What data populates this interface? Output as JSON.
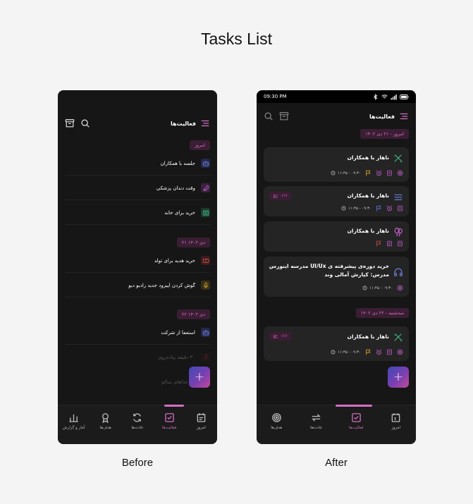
{
  "page_title": "Tasks List",
  "captions": {
    "before": "Before",
    "after": "After"
  },
  "colors": {
    "accent": "#d46fc3",
    "chip_bg": "#3a1e33",
    "card_bg": "#242424",
    "screen_bg": "#161616"
  },
  "app": {
    "title": "فعالیت‌ها"
  },
  "before": {
    "groups": [
      {
        "chip": "امروز",
        "tasks": [
          {
            "label": "جلسه با همکاران",
            "icon": "briefcase-icon",
            "color": "#6a7bd8"
          },
          {
            "label": "وقت دندان پزشکی",
            "icon": "rocket-icon",
            "color": "#c85fd1"
          },
          {
            "label": "خرید برای خانه",
            "icon": "store-icon",
            "color": "#3fb37a"
          }
        ]
      },
      {
        "chip": "۲۱ دی ۱۴۰۲",
        "tasks": [
          {
            "label": "خرید هدیه برای تولد",
            "icon": "ticket-icon",
            "color": "#d24a4a"
          },
          {
            "label": "گوش کردن اپیزود جدید رادیو دیو",
            "icon": "microphone-icon",
            "color": "#c89a2a"
          }
        ]
      },
      {
        "chip": "۲۲ دی ۱۴۰۲",
        "tasks": [
          {
            "label": "استعفا از شرکت",
            "icon": "briefcase-icon",
            "color": "#6a7bd8"
          }
        ]
      }
    ],
    "faded_tasks": [
      {
        "label": "۳۰ دقیقه پیاده‌روی",
        "icon": "walk-icon",
        "color": "#d24a4a"
      },
      {
        "label": "دن غذاهای سالم",
        "icon": "food-icon",
        "color": "#888888"
      }
    ],
    "nav": [
      {
        "label": "امروز",
        "icon": "calendar-icon",
        "active": false
      },
      {
        "label": "فعالیت‌ها",
        "icon": "checkbox-icon",
        "active": true
      },
      {
        "label": "عادت‌ها",
        "icon": "repeat-icon",
        "active": false
      },
      {
        "label": "هدف‌ها",
        "icon": "medal-icon",
        "active": false
      },
      {
        "label": "آمار و گزارش",
        "icon": "chart-icon",
        "active": false
      }
    ]
  },
  "after": {
    "status": {
      "time": "09:30 PM"
    },
    "groups": [
      {
        "chip": "امروز - ۲۱ دی ۱۴۰۲",
        "cards": [
          {
            "title": "ناهار با همکاران",
            "icon": "utensils-icon",
            "color": "#3fb37a",
            "time": "۱۱:۴۵ - ۰۹:۳۰",
            "badge": "",
            "meta": [
              "target-icon",
              "note-icon",
              "alarm-icon",
              "flag-icon"
            ],
            "flag_color": "#e0a92b"
          },
          {
            "title": "ناهار با همکاران",
            "icon": "waves-icon",
            "color": "#6a7bd8",
            "time": "۱۱:۴۵ - ۰۹:۳۰",
            "badge": "۰/۱۶",
            "meta": [
              "note-icon",
              "alarm-icon",
              "flag-icon"
            ],
            "flag_color": "#5b7be0"
          },
          {
            "title": "ناهار با همکاران",
            "icon": "balloon-icon",
            "color": "#c85fd1",
            "time": "",
            "badge": "",
            "meta": [
              "note-icon",
              "note2-icon",
              "flag-icon"
            ],
            "flag_color": "#d24a4a"
          },
          {
            "title": "خرید دوره‌ی پیشرفته ی UI/Ux مدرسه اینورس مدرس: کیارش آمالی وند",
            "icon": "headphones-icon",
            "color": "#6a7bd8",
            "time": "۱۱:۴۵ - ۰۹:۳۰",
            "badge": "",
            "meta": [
              "target-icon"
            ],
            "flag_color": ""
          }
        ]
      },
      {
        "chip": "سه‌شنبه - ۲۲ دی ۱۴۰۲",
        "cards": [
          {
            "title": "ناهار با همکاران",
            "icon": "utensils-icon",
            "color": "#3fb37a",
            "time": "۱۱:۴۵ - ۰۹:۳۰",
            "badge": "۰/۱۶",
            "meta": [
              "target-icon",
              "note-icon",
              "alarm-icon",
              "flag-icon"
            ],
            "flag_color": "#e0a92b"
          }
        ]
      }
    ],
    "nav": [
      {
        "label": "امروز",
        "icon": "calendar-icon",
        "active": false
      },
      {
        "label": "فعالیت‌ها",
        "icon": "checkbox-icon",
        "active": true
      },
      {
        "label": "عادت‌ها",
        "icon": "repeat-icon",
        "active": false
      },
      {
        "label": "هدف‌ها",
        "icon": "target-icon",
        "active": false
      }
    ]
  }
}
